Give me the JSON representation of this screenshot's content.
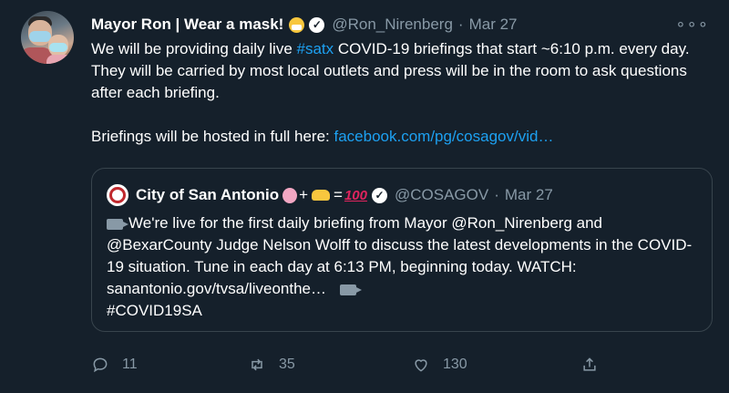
{
  "tweet": {
    "author_name": "Mayor Ron | Wear a mask!",
    "author_emoji": "mask-face-emoji",
    "handle": "@Ron_Nirenberg",
    "separator": "·",
    "date": "Mar 27",
    "more": "∘∘∘",
    "text_part1": "We will be providing daily live ",
    "hashtag": "#satx",
    "text_part2": " COVID-19 briefings that start ~6:10 p.m. every day. They will be carried by most local outlets and press will be in the room to ask questions after each briefing.",
    "text_part3": "Briefings will be hosted in full here: ",
    "link": "facebook.com/pg/cosagov/vid…"
  },
  "quote": {
    "author_name": "City of San Antonio",
    "emoji_plus": "+",
    "emoji_equals": "=",
    "emoji_100": "100",
    "handle": "@COSAGOV",
    "separator": "·",
    "date": "Mar 27",
    "text_main": "We're live for the first daily briefing from Mayor @Ron_Nirenberg and @BexarCounty Judge Nelson Wolff to discuss the latest developments in the COVID-19 situation. Tune in each day at 6:13 PM, beginning today. WATCH: sanantonio.gov/tvsa/liveonthe…",
    "text_tag": "#COVID19SA"
  },
  "actions": {
    "reply_count": "11",
    "retweet_count": "35",
    "like_count": "130"
  },
  "colors": {
    "background": "#15202b",
    "link": "#1da1f2",
    "muted": "#8899a6",
    "border": "#38444d"
  }
}
